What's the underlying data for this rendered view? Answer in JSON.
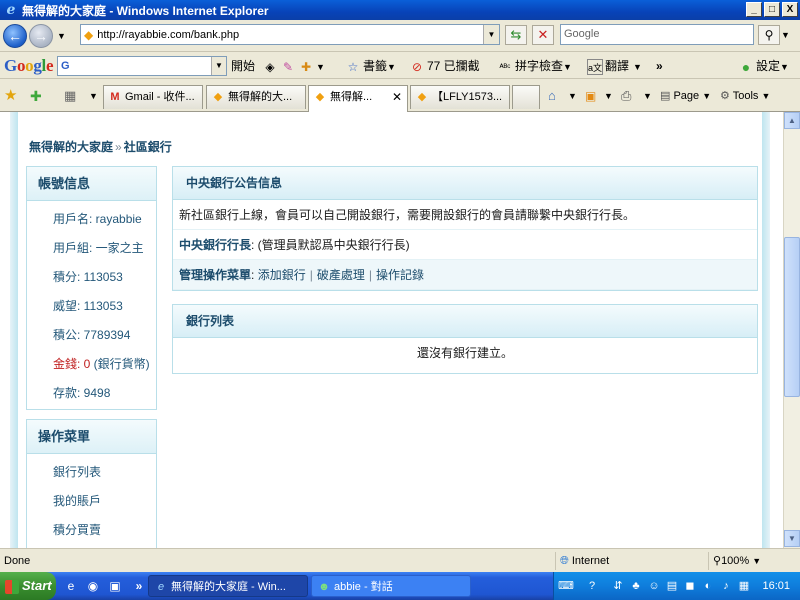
{
  "window": {
    "title": "無得解的大家庭 - Windows Internet Explorer",
    "min": "_",
    "max": "□",
    "close": "X"
  },
  "address": {
    "url": "http://rayabbie.com/bank.php",
    "search_placeholder": "Google"
  },
  "google_toolbar": {
    "start": "開始",
    "bookmarks": "書籤",
    "blocked": "77 已攔截",
    "spellcheck": "拼字檢查",
    "translate": "翻譯",
    "more": "»",
    "settings": "設定"
  },
  "tabs": [
    {
      "label": "Gmail - 收件..."
    },
    {
      "label": "無得解的大..."
    },
    {
      "label": "無得解..."
    },
    {
      "label": "【LFLY1573..."
    }
  ],
  "tab_tools": {
    "page": "Page",
    "tools": "Tools"
  },
  "breadcrumb": {
    "home": "無得解的大家庭",
    "sep": "»",
    "current": "社區銀行"
  },
  "account": {
    "title": "帳號信息",
    "items": [
      {
        "label": "用戶名: ",
        "value": "rayabbie"
      },
      {
        "label": "用戶組: ",
        "value": "一家之主"
      },
      {
        "label": "積分: ",
        "value": "113053"
      },
      {
        "label": "威望: ",
        "value": "113053"
      },
      {
        "label": "積公: ",
        "value": "7789394"
      },
      {
        "label": "存款: ",
        "value": "9498"
      }
    ],
    "money_label": "金錢: 0",
    "money_unit": " (銀行貨幣)"
  },
  "ops_menu": {
    "title": "操作菜單",
    "items": [
      {
        "label": "銀行列表"
      },
      {
        "label": "我的賬戶"
      },
      {
        "label": "積分買賣"
      }
    ]
  },
  "notice": {
    "title": "中央銀行公告信息",
    "message": "新社區銀行上線，會員可以自己開設銀行，需要開設銀行的會員請聯繫中央銀行行長。",
    "president_label": "中央銀行行長",
    "president_value": ": (管理員默認爲中央銀行行長)",
    "admin_label": "管理操作菜單",
    "admin_colon": ":",
    "link_add": "添加銀行",
    "link_bankrupt": "破產處理",
    "link_log": "操作記錄",
    "pipe": "|"
  },
  "bank_list": {
    "title": "銀行列表",
    "empty": "還沒有銀行建立。"
  },
  "statusbar": {
    "status": "Done",
    "zone": "Internet",
    "zoom": "100%"
  },
  "taskbar": {
    "start": "Start",
    "tasks": [
      {
        "label": "無得解的大家庭 - Win..."
      },
      {
        "label": "abbie - 對話"
      }
    ],
    "more": "»",
    "clock": "16:01"
  }
}
